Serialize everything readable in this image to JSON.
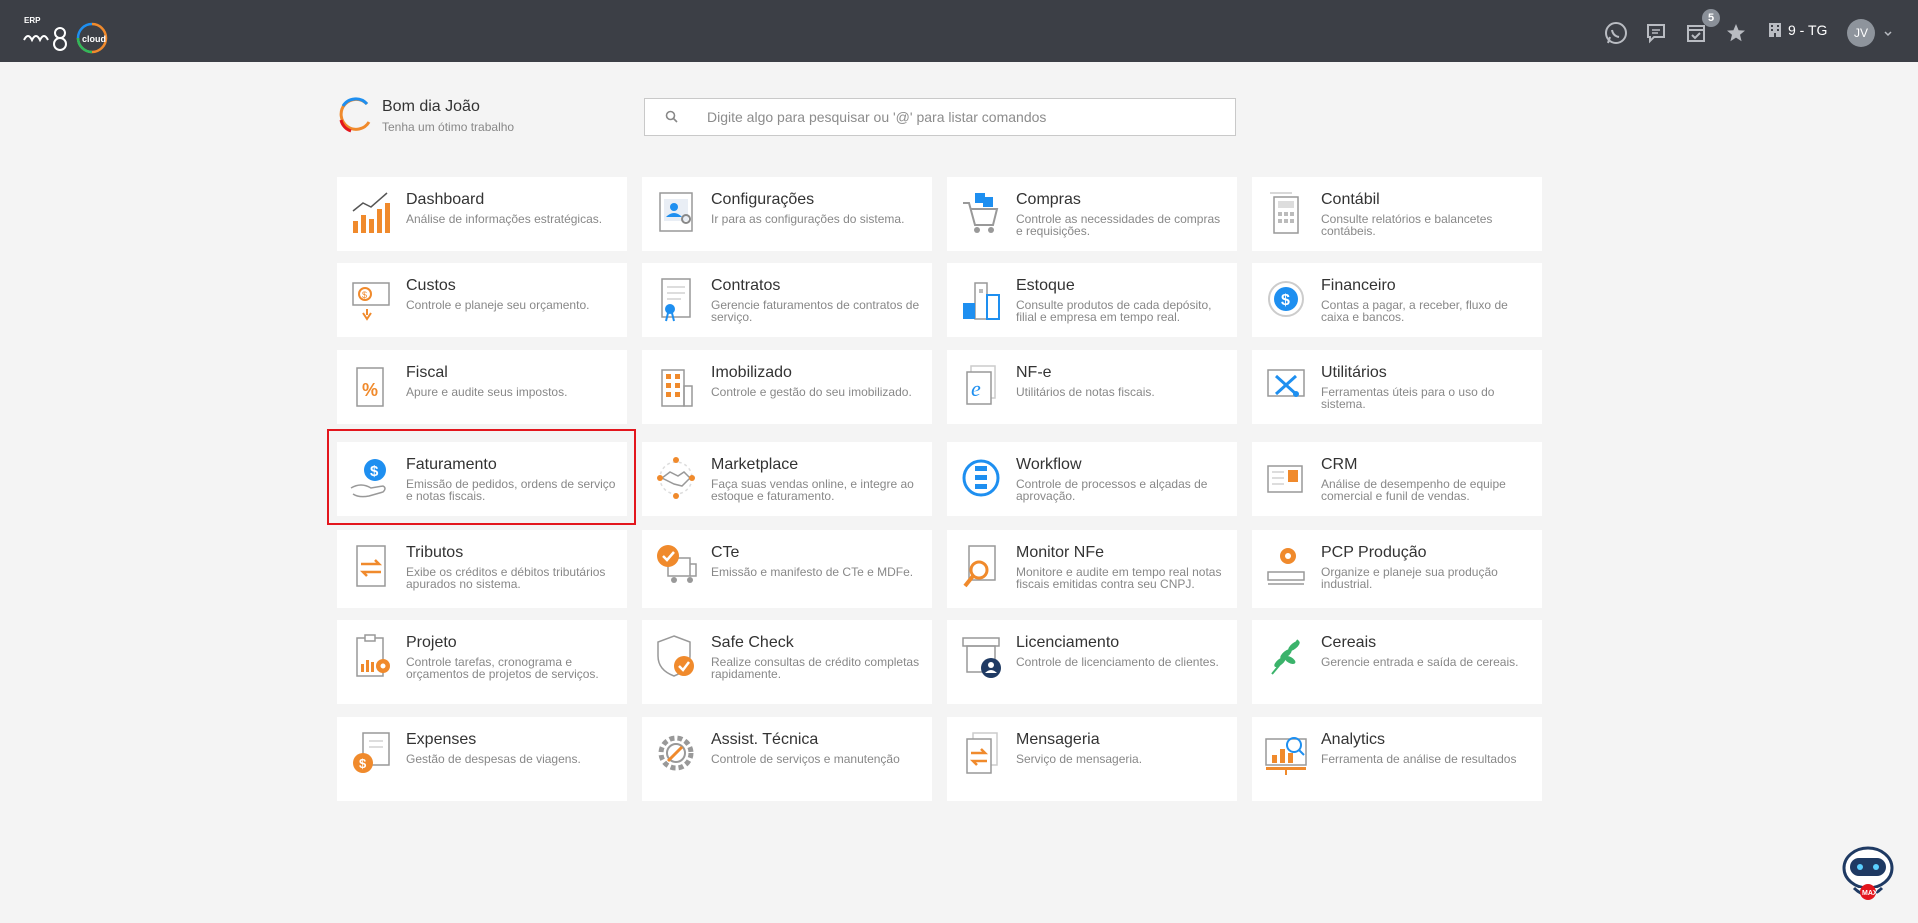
{
  "brand": {
    "erp_label": "ERP",
    "name": "m8",
    "suffix": "cloud"
  },
  "topbar": {
    "icons": [
      "whatsapp-icon",
      "chat-icon",
      "calendar-icon",
      "star-icon"
    ],
    "notifications_badge": "5",
    "company": "9 - TG",
    "avatar_initials": "JV"
  },
  "greeting": {
    "title": "Bom dia João",
    "subtitle": "Tenha um ótimo trabalho"
  },
  "search": {
    "placeholder": "Digite algo para pesquisar ou '@' para listar comandos"
  },
  "modules": [
    {
      "title": "Dashboard",
      "desc": "Análise de informações estratégicas.",
      "icon": "chart-icon"
    },
    {
      "title": "Configurações",
      "desc": "Ir para as configurações do sistema.",
      "icon": "settings-profile-icon"
    },
    {
      "title": "Compras",
      "desc": "Controle as necessidades de compras e requisições.",
      "icon": "shopping-cart-icon"
    },
    {
      "title": "Contábil",
      "desc": "Consulte relatórios e balancetes contábeis.",
      "icon": "calculator-icon"
    },
    {
      "title": "Custos",
      "desc": "Controle e planeje seu orçamento.",
      "icon": "cost-money-icon"
    },
    {
      "title": "Contratos",
      "desc": "Gerencie faturamentos de contratos de serviço.",
      "icon": "contract-icon"
    },
    {
      "title": "Estoque",
      "desc": "Consulte produtos de cada depósito, filial e empresa em tempo real.",
      "icon": "warehouse-icon"
    },
    {
      "title": "Financeiro",
      "desc": "Contas a pagar, a receber, fluxo de caixa e bancos.",
      "icon": "dollar-coin-icon"
    },
    {
      "title": "Fiscal",
      "desc": "Apure e audite seus impostos.",
      "icon": "tax-percent-icon"
    },
    {
      "title": "Imobilizado",
      "desc": "Controle e gestão do seu imobilizado.",
      "icon": "building-icon"
    },
    {
      "title": "NF-e",
      "desc": "Utilitários de notas fiscais.",
      "icon": "invoice-e-icon"
    },
    {
      "title": "Utilitários",
      "desc": "Ferramentas úteis para o uso do sistema.",
      "icon": "tools-icon"
    },
    {
      "title": "Faturamento",
      "desc": "Emissão de pedidos, ordens de serviço e notas fiscais.",
      "icon": "billing-hand-icon"
    },
    {
      "title": "Marketplace",
      "desc": "Faça suas vendas online, e integre ao estoque e faturamento.",
      "icon": "handshake-icon"
    },
    {
      "title": "Workflow",
      "desc": "Controle de processos e alçadas de aprovação.",
      "icon": "workflow-icon"
    },
    {
      "title": "CRM",
      "desc": "Análise de desempenho de equipe comercial e funil de vendas.",
      "icon": "crm-card-icon"
    },
    {
      "title": "Tributos",
      "desc": "Exibe os créditos e débitos tributários apurados no sistema.",
      "icon": "tax-transfer-icon"
    },
    {
      "title": "CTe",
      "desc": "Emissão e manifesto de CTe e MDFe.",
      "icon": "truck-check-icon"
    },
    {
      "title": "Monitor NFe",
      "desc": "Monitore e audite em tempo real notas fiscais emitidas contra seu CNPJ.",
      "icon": "magnifier-doc-icon"
    },
    {
      "title": "PCP Produção",
      "desc": "Organize e planeje sua produção industrial.",
      "icon": "production-gear-icon"
    },
    {
      "title": "Projeto",
      "desc": "Controle tarefas, cronograma e orçamentos de projetos de serviços.",
      "icon": "project-clipboard-icon"
    },
    {
      "title": "Safe Check",
      "desc": "Realize consultas de crédito completas rapidamente.",
      "icon": "shield-check-icon"
    },
    {
      "title": "Licenciamento",
      "desc": "Controle de licenciamento de clientes.",
      "icon": "license-store-icon"
    },
    {
      "title": "Cereais",
      "desc": "Gerencie entrada e saída de cereais.",
      "icon": "leaf-icon"
    },
    {
      "title": "Expenses",
      "desc": "Gestão de despesas de viagens.",
      "icon": "expenses-icon"
    },
    {
      "title": "Assist. Técnica",
      "desc": "Controle de serviços e manutenção",
      "icon": "gear-icon"
    },
    {
      "title": "Mensageria",
      "desc": "Serviço de mensageria.",
      "icon": "message-doc-icon"
    },
    {
      "title": "Analytics",
      "desc": "Ferramenta de análise de resultados",
      "icon": "analytics-icon"
    }
  ],
  "assistant": {
    "label": "MAX"
  },
  "colors": {
    "topbar": "#3c3f46",
    "accent_orange": "#f08a2c",
    "accent_blue": "#1e8ff0",
    "highlight_red": "#e3161d"
  }
}
